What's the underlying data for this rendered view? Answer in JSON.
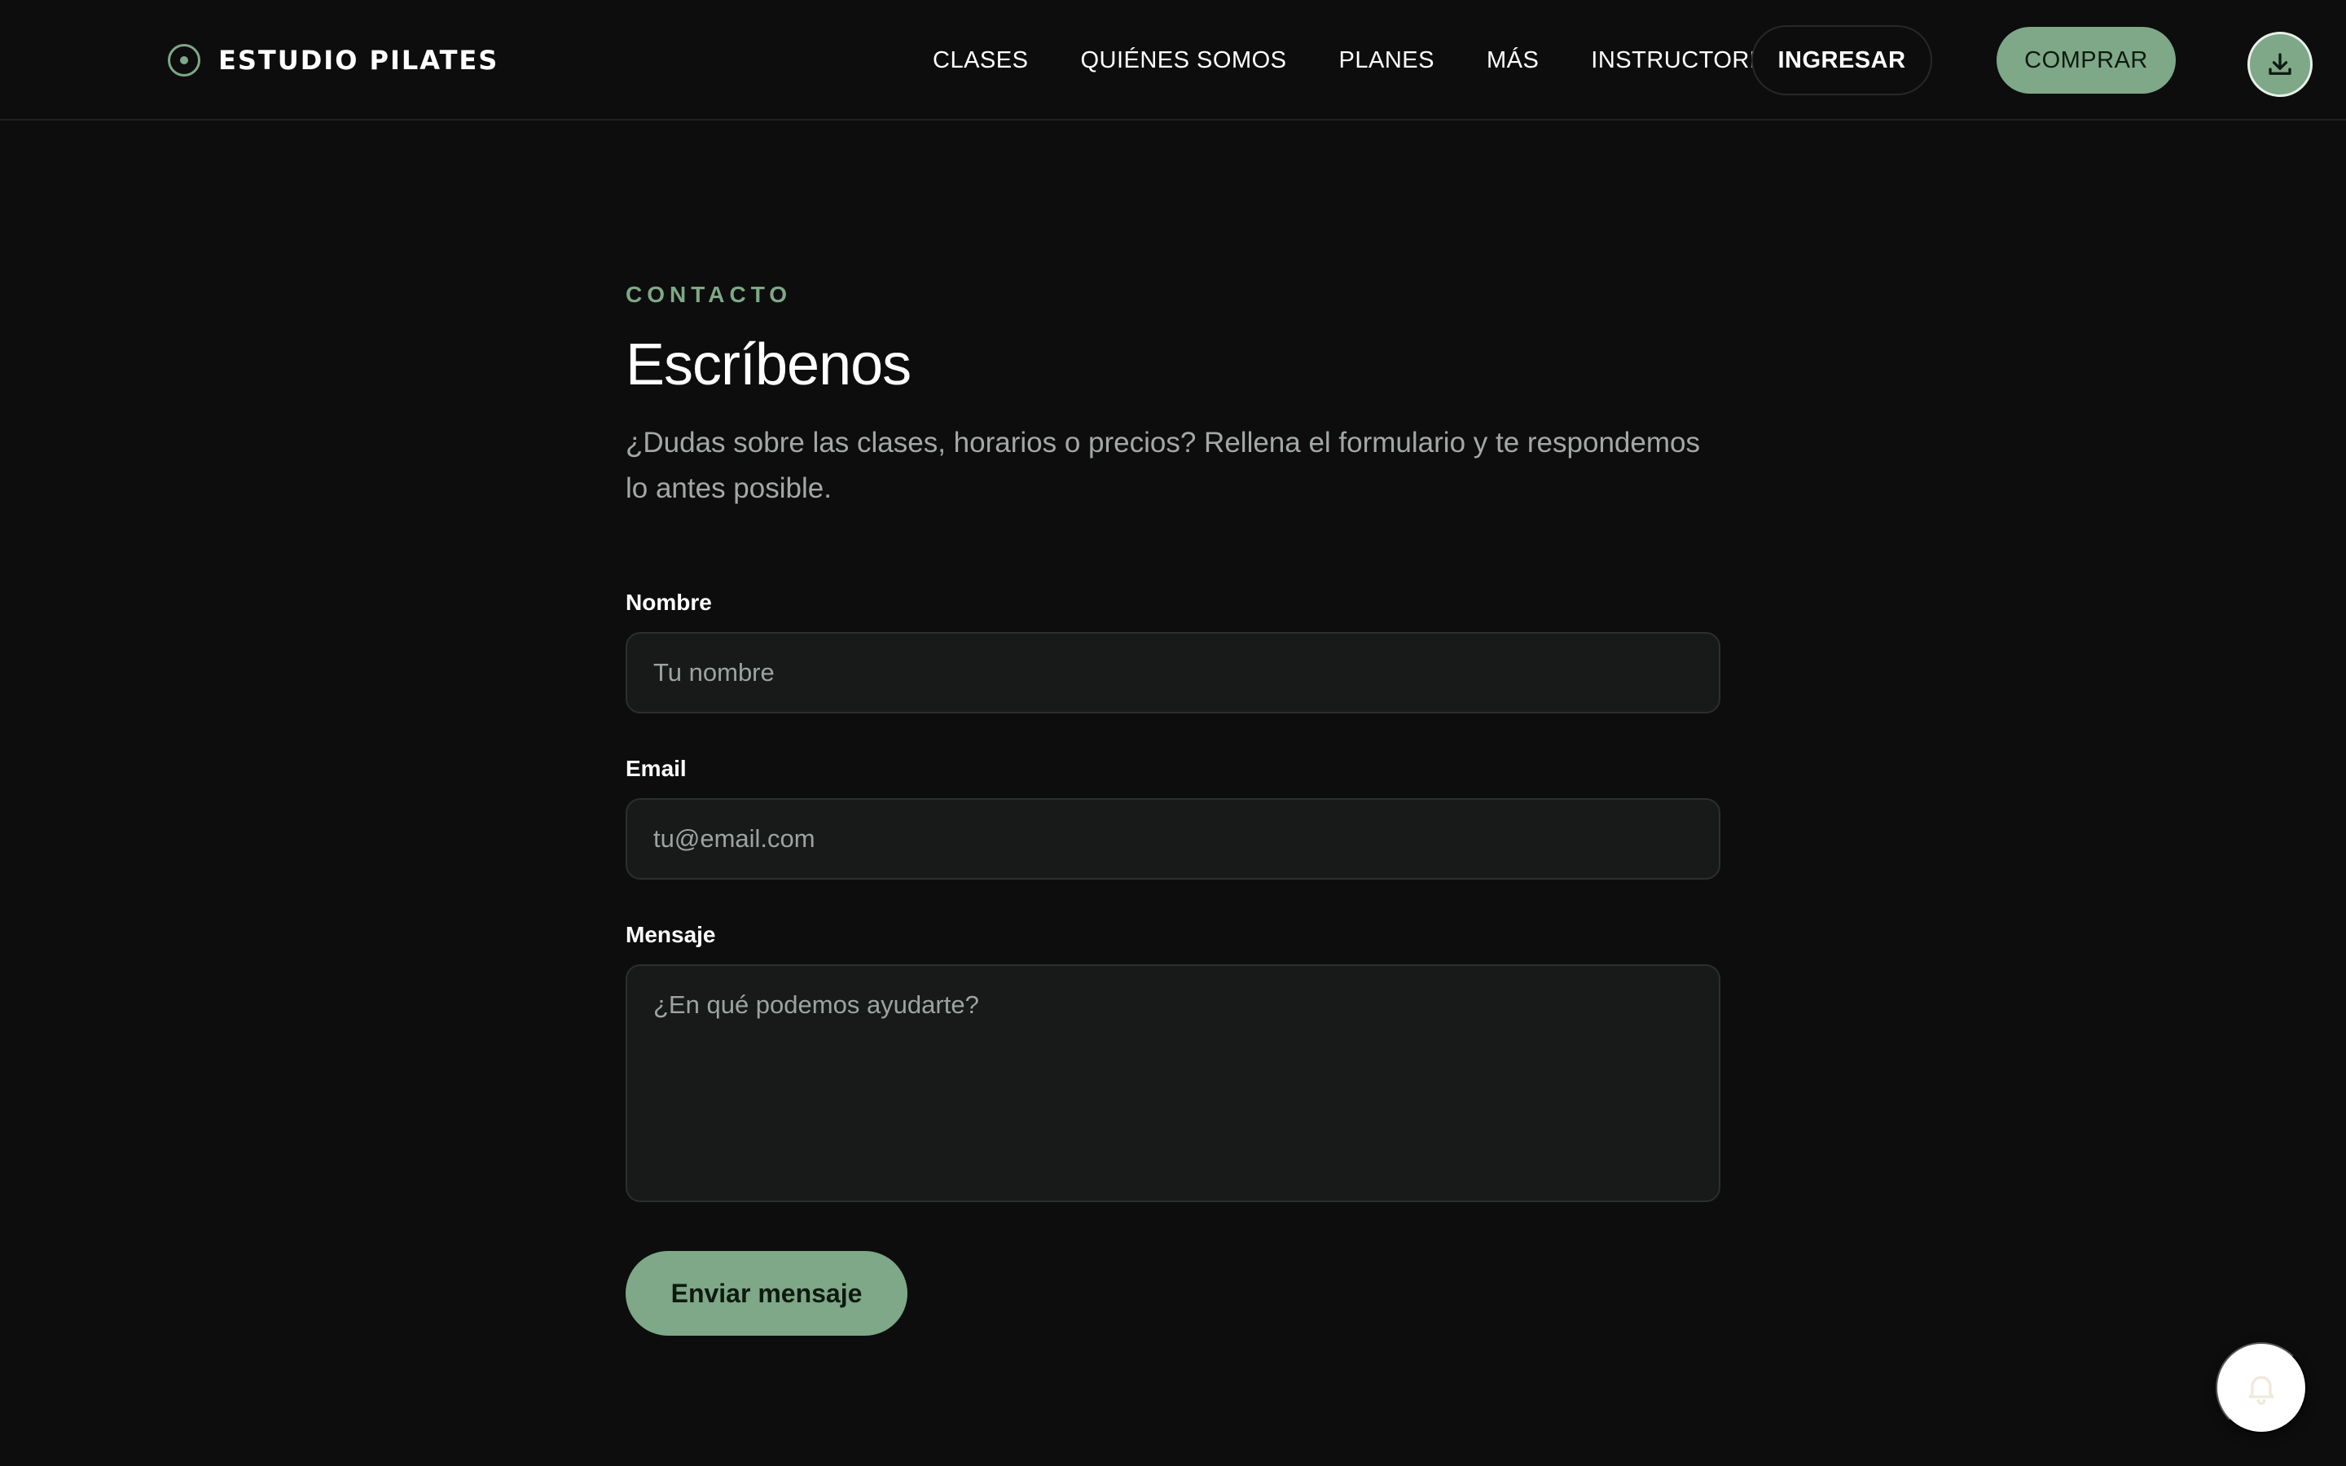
{
  "header": {
    "brand_name": "ESTUDIO PILATES",
    "nav": [
      "CLASES",
      "QUIÉNES SOMOS",
      "PLANES",
      "MÁS",
      "INSTRUCTORES"
    ],
    "login_label": "INGRESAR",
    "buy_label": "COMPRAR",
    "download_icon": "download-icon"
  },
  "contact": {
    "eyebrow": "CONTACTO",
    "title": "Escríbenos",
    "lead": "¿Dudas sobre las clases, horarios o precios? Rellena el formulario y te respondemos lo antes posible.",
    "fields": {
      "name": {
        "label": "Nombre",
        "placeholder": "Tu nombre",
        "value": ""
      },
      "email": {
        "label": "Email",
        "placeholder": "tu@email.com",
        "value": ""
      },
      "message": {
        "label": "Mensaje",
        "placeholder": "¿En qué podemos ayudarte?",
        "value": ""
      }
    },
    "submit_label": "Enviar mensaje"
  },
  "floating": {
    "icon": "bell-icon"
  },
  "colors": {
    "background": "#0d0d0d",
    "accent": "#7ea887",
    "input_background": "#171a19",
    "muted_text": "#a4a8a5"
  }
}
